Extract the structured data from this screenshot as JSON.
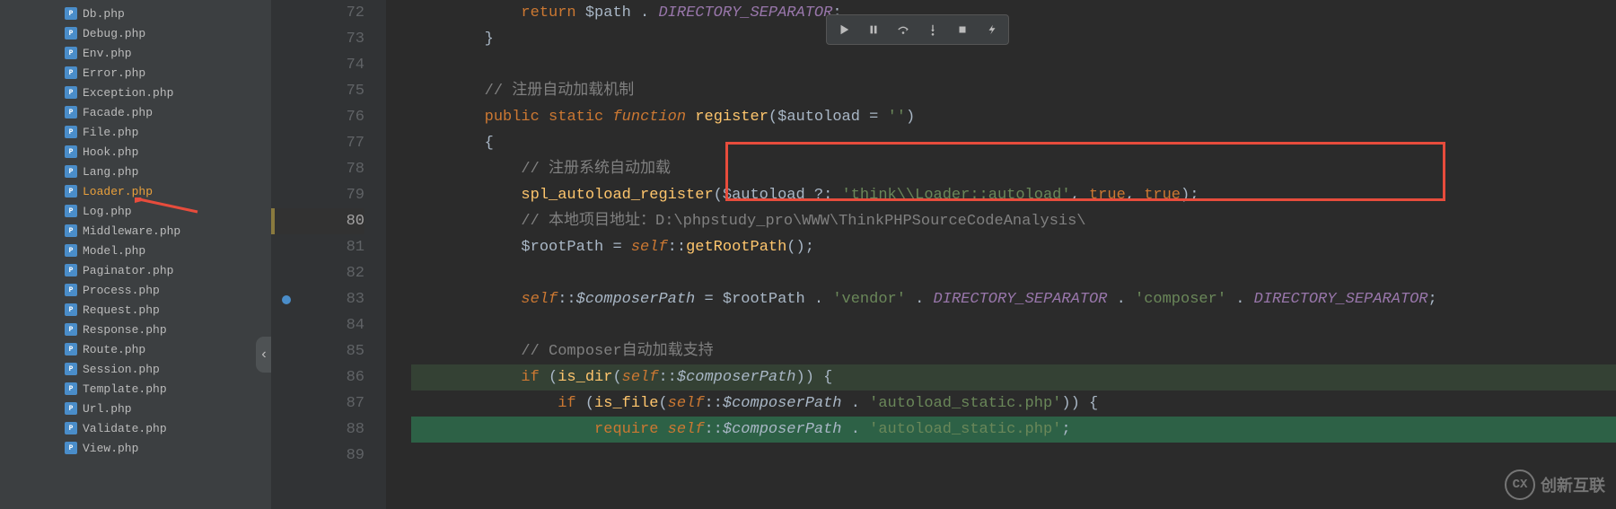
{
  "sidebar": {
    "files": [
      {
        "name": "Db.php"
      },
      {
        "name": "Debug.php"
      },
      {
        "name": "Env.php"
      },
      {
        "name": "Error.php"
      },
      {
        "name": "Exception.php"
      },
      {
        "name": "Facade.php"
      },
      {
        "name": "File.php"
      },
      {
        "name": "Hook.php"
      },
      {
        "name": "Lang.php"
      },
      {
        "name": "Loader.php",
        "selected": true
      },
      {
        "name": "Log.php"
      },
      {
        "name": "Middleware.php"
      },
      {
        "name": "Model.php"
      },
      {
        "name": "Paginator.php"
      },
      {
        "name": "Process.php"
      },
      {
        "name": "Request.php"
      },
      {
        "name": "Response.php"
      },
      {
        "name": "Route.php"
      },
      {
        "name": "Session.php"
      },
      {
        "name": "Template.php"
      },
      {
        "name": "Url.php"
      },
      {
        "name": "Validate.php"
      },
      {
        "name": "View.php"
      }
    ]
  },
  "editor": {
    "lines": [
      {
        "num": "72",
        "tokens": [
          {
            "t": "            ",
            "c": ""
          },
          {
            "t": "return",
            "c": "c-kw"
          },
          {
            "t": " ",
            "c": ""
          },
          {
            "t": "$path",
            "c": "c-var"
          },
          {
            "t": " . ",
            "c": ""
          },
          {
            "t": "DIRECTORY_SEPARATOR",
            "c": "c-const c-it"
          },
          {
            "t": ";",
            "c": ""
          }
        ]
      },
      {
        "num": "73",
        "tokens": [
          {
            "t": "        }",
            "c": ""
          }
        ]
      },
      {
        "num": "74",
        "tokens": []
      },
      {
        "num": "75",
        "tokens": [
          {
            "t": "        ",
            "c": ""
          },
          {
            "t": "// 注册自动加载机制",
            "c": "c-com"
          }
        ]
      },
      {
        "num": "76",
        "tokens": [
          {
            "t": "        ",
            "c": ""
          },
          {
            "t": "public",
            "c": "c-kw"
          },
          {
            "t": " ",
            "c": ""
          },
          {
            "t": "static",
            "c": "c-kw"
          },
          {
            "t": " ",
            "c": ""
          },
          {
            "t": "function",
            "c": "c-kw c-it"
          },
          {
            "t": " ",
            "c": ""
          },
          {
            "t": "register",
            "c": "c-fn"
          },
          {
            "t": "(",
            "c": ""
          },
          {
            "t": "$autoload",
            "c": "c-var"
          },
          {
            "t": " = ",
            "c": ""
          },
          {
            "t": "''",
            "c": "c-str"
          },
          {
            "t": ")",
            "c": ""
          }
        ]
      },
      {
        "num": "77",
        "tokens": [
          {
            "t": "        {",
            "c": ""
          }
        ]
      },
      {
        "num": "78",
        "tokens": [
          {
            "t": "            ",
            "c": ""
          },
          {
            "t": "// 注册系统自动加载",
            "c": "c-com"
          }
        ]
      },
      {
        "num": "79",
        "tokens": [
          {
            "t": "            ",
            "c": ""
          },
          {
            "t": "spl_autoload_register",
            "c": "c-fn"
          },
          {
            "t": "(",
            "c": ""
          },
          {
            "t": "$autoload",
            "c": "c-var"
          },
          {
            "t": " ?: ",
            "c": ""
          },
          {
            "t": "'think\\\\Loader::autoload'",
            "c": "c-str"
          },
          {
            "t": ", ",
            "c": ""
          },
          {
            "t": "true",
            "c": "c-kw"
          },
          {
            "t": ", ",
            "c": ""
          },
          {
            "t": "true",
            "c": "c-kw"
          },
          {
            "t": ");",
            "c": ""
          }
        ]
      },
      {
        "num": "80",
        "current": true,
        "mod": true,
        "tokens": [
          {
            "t": "            ",
            "c": ""
          },
          {
            "t": "// 本地项目地址：D:\\phpstudy_pro\\WWW\\ThinkPHPSourceCodeAnalysis\\",
            "c": "c-com"
          }
        ]
      },
      {
        "num": "81",
        "tokens": [
          {
            "t": "            ",
            "c": ""
          },
          {
            "t": "$rootPath",
            "c": "c-var"
          },
          {
            "t": " = ",
            "c": ""
          },
          {
            "t": "self",
            "c": "c-kw c-it"
          },
          {
            "t": "::",
            "c": ""
          },
          {
            "t": "getRootPath",
            "c": "c-fn"
          },
          {
            "t": "();",
            "c": ""
          }
        ]
      },
      {
        "num": "82",
        "tokens": []
      },
      {
        "num": "83",
        "bp": true,
        "tokens": [
          {
            "t": "            ",
            "c": ""
          },
          {
            "t": "self",
            "c": "c-kw c-it"
          },
          {
            "t": "::",
            "c": ""
          },
          {
            "t": "$composerPath",
            "c": "c-var c-it"
          },
          {
            "t": " = ",
            "c": ""
          },
          {
            "t": "$rootPath",
            "c": "c-var"
          },
          {
            "t": " . ",
            "c": ""
          },
          {
            "t": "'vendor'",
            "c": "c-str"
          },
          {
            "t": " . ",
            "c": ""
          },
          {
            "t": "DIRECTORY_SEPARATOR",
            "c": "c-const c-it"
          },
          {
            "t": " . ",
            "c": ""
          },
          {
            "t": "'composer'",
            "c": "c-str"
          },
          {
            "t": " . ",
            "c": ""
          },
          {
            "t": "DIRECTORY_SEPARATOR",
            "c": "c-const c-it"
          },
          {
            "t": ";",
            "c": ""
          }
        ]
      },
      {
        "num": "84",
        "tokens": []
      },
      {
        "num": "85",
        "tokens": [
          {
            "t": "            ",
            "c": ""
          },
          {
            "t": "// Composer自动加载支持",
            "c": "c-com"
          }
        ]
      },
      {
        "num": "86",
        "hl": "hl86",
        "tokens": [
          {
            "t": "            ",
            "c": ""
          },
          {
            "t": "if",
            "c": "c-kw"
          },
          {
            "t": " (",
            "c": ""
          },
          {
            "t": "is_dir",
            "c": "c-fn"
          },
          {
            "t": "(",
            "c": ""
          },
          {
            "t": "self",
            "c": "c-kw c-it"
          },
          {
            "t": "::",
            "c": ""
          },
          {
            "t": "$composerPath",
            "c": "c-var c-it"
          },
          {
            "t": ")) {",
            "c": ""
          }
        ]
      },
      {
        "num": "87",
        "tokens": [
          {
            "t": "                ",
            "c": ""
          },
          {
            "t": "if",
            "c": "c-kw"
          },
          {
            "t": " (",
            "c": ""
          },
          {
            "t": "is_file",
            "c": "c-fn"
          },
          {
            "t": "(",
            "c": ""
          },
          {
            "t": "self",
            "c": "c-kw c-it"
          },
          {
            "t": "::",
            "c": ""
          },
          {
            "t": "$composerPath",
            "c": "c-var c-it"
          },
          {
            "t": " . ",
            "c": ""
          },
          {
            "t": "'autoload_static.php'",
            "c": "c-str"
          },
          {
            "t": ")) {",
            "c": ""
          }
        ]
      },
      {
        "num": "88",
        "hl": "hl88",
        "tokens": [
          {
            "t": "                    ",
            "c": ""
          },
          {
            "t": "require",
            "c": "c-kw"
          },
          {
            "t": " ",
            "c": ""
          },
          {
            "t": "self",
            "c": "c-kw c-it"
          },
          {
            "t": "::",
            "c": ""
          },
          {
            "t": "$composerPath",
            "c": "c-var c-it"
          },
          {
            "t": " . ",
            "c": ""
          },
          {
            "t": "'autoload_static.php'",
            "c": "c-str"
          },
          {
            "t": ";",
            "c": ""
          }
        ]
      },
      {
        "num": "89",
        "tokens": []
      }
    ]
  },
  "watermark": {
    "text": "创新互联",
    "badge": "CX"
  }
}
